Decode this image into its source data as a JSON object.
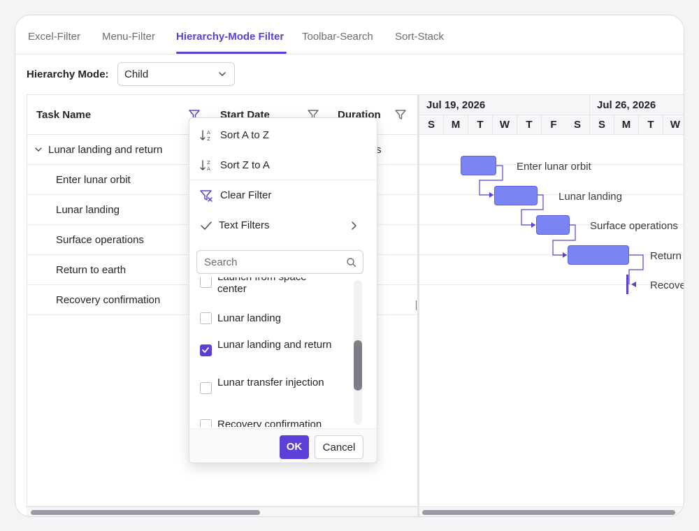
{
  "tabs": [
    {
      "label": "Excel-Filter"
    },
    {
      "label": "Menu-Filter"
    },
    {
      "label": "Hierarchy-Mode Filter"
    },
    {
      "label": "Toolbar-Search"
    },
    {
      "label": "Sort-Stack"
    }
  ],
  "active_tab": "Hierarchy-Mode Filter",
  "hierarchy_mode": {
    "label": "Hierarchy Mode:",
    "value": "Child"
  },
  "grid": {
    "columns": [
      {
        "title": "Task Name"
      },
      {
        "title": "Start Date"
      },
      {
        "title": "Duration"
      }
    ],
    "rows": [
      {
        "name": "Lunar landing and return",
        "duration_tail": "s"
      },
      {
        "name": "Enter lunar orbit",
        "duration_tail": ""
      },
      {
        "name": "Lunar landing",
        "duration_tail": ""
      },
      {
        "name": "Surface operations",
        "duration_tail": ""
      },
      {
        "name": "Return to earth",
        "duration_tail": ""
      },
      {
        "name": "Recovery confirmation",
        "duration_tail": ""
      }
    ]
  },
  "timeline": {
    "weeks": [
      "Jul 19, 2026",
      "Jul 26, 2026"
    ],
    "days": [
      "S",
      "M",
      "T",
      "W",
      "T",
      "F",
      "S",
      "S",
      "M",
      "T",
      "W"
    ],
    "bar_labels": [
      "Enter lunar orbit",
      "Lunar landing",
      "Surface operations",
      "Return to earth",
      "Recovery confirmation"
    ]
  },
  "filter_popup": {
    "sort_asc": "Sort A to Z",
    "sort_desc": "Sort Z to A",
    "clear_filter": "Clear Filter",
    "text_filters": "Text Filters",
    "search_placeholder": "Search",
    "items": [
      {
        "label": "Launch from space center",
        "checked": false
      },
      {
        "label": "Lunar landing",
        "checked": false
      },
      {
        "label": "Lunar landing and return",
        "checked": true
      },
      {
        "label": "Lunar transfer injection",
        "checked": false
      },
      {
        "label": "Recovery confirmation",
        "checked": false
      }
    ],
    "ok_label": "OK",
    "cancel_label": "Cancel"
  },
  "colors": {
    "accent": "#5b3fd6",
    "bar_fill": "#7b84f5",
    "bar_border": "#5a63d8"
  }
}
